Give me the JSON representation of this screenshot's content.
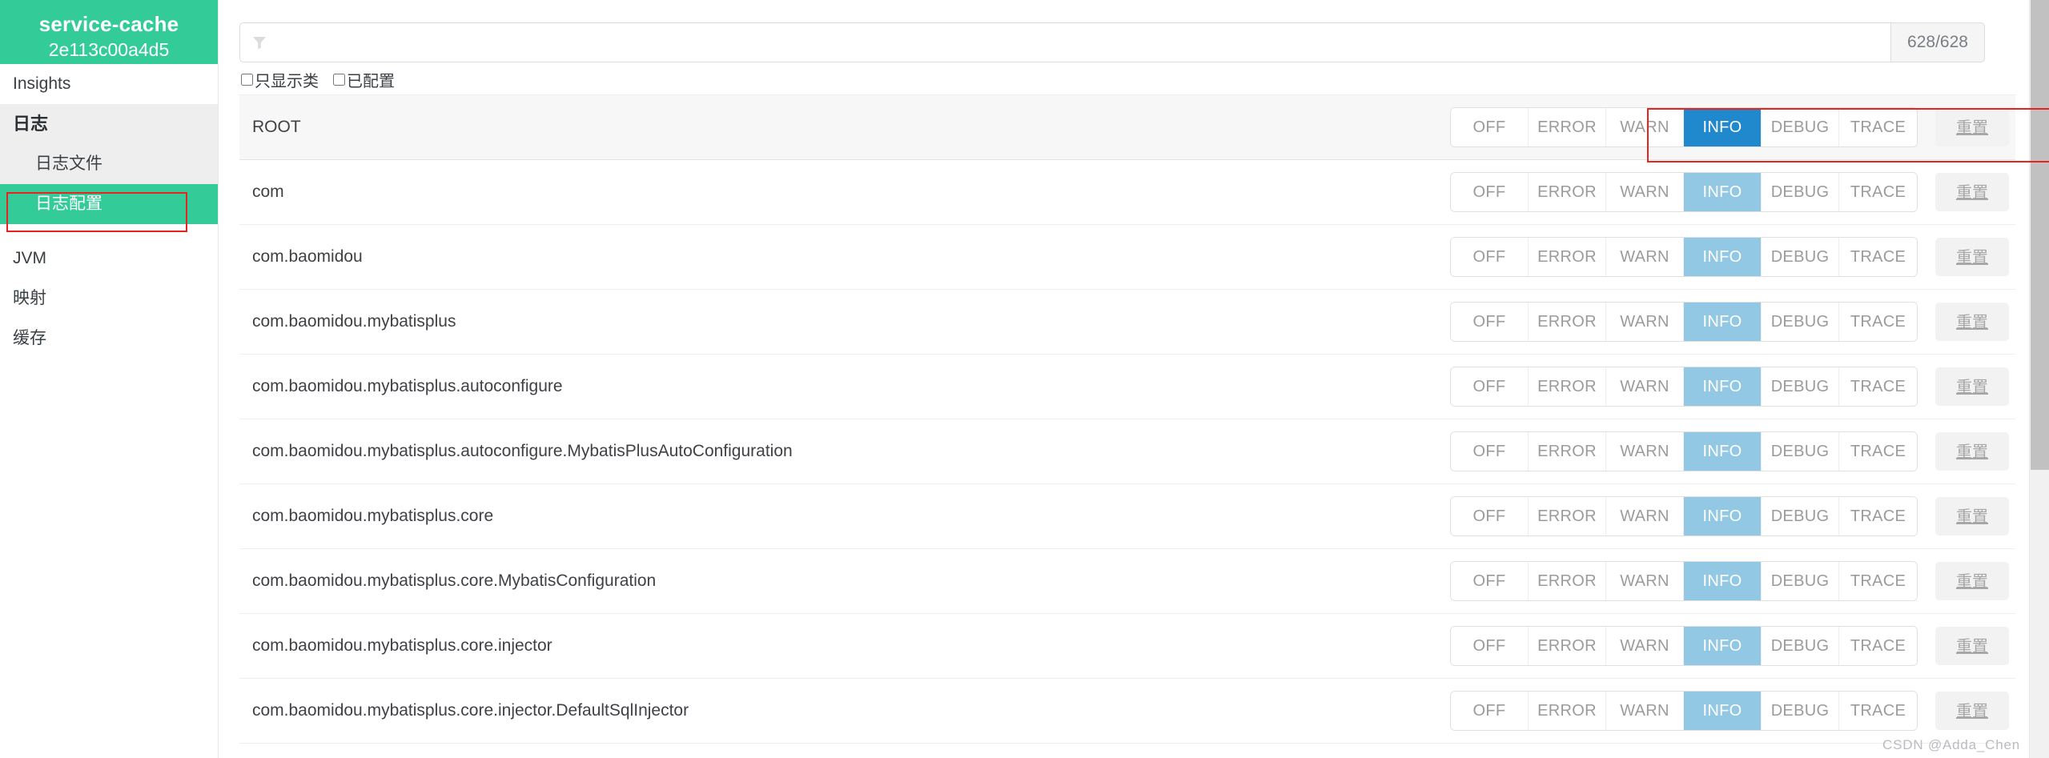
{
  "colors": {
    "brand_green": "#33cc99",
    "active_level_root": "#2088cd",
    "active_level_row": "#92c8e4",
    "annotation_red": "#e8221f",
    "row_root_bg": "#f7f7f7"
  },
  "sidebar": {
    "brand": {
      "title": "service-cache",
      "instance_id": "2e113c00a4d5"
    },
    "items": [
      {
        "label": "Insights",
        "type": "link",
        "active": false
      },
      {
        "label": "日志",
        "type": "section",
        "active": false
      },
      {
        "label": "日志文件",
        "type": "child",
        "active": false
      },
      {
        "label": "日志配置",
        "type": "child",
        "active": true
      },
      {
        "label": "JVM",
        "type": "link",
        "active": false
      },
      {
        "label": "映射",
        "type": "link",
        "active": false
      },
      {
        "label": "缓存",
        "type": "link",
        "active": false
      }
    ]
  },
  "toolbar": {
    "filter": {
      "icon": "funnel-icon",
      "value": "",
      "placeholder": ""
    },
    "count_badge": "628/628",
    "checkboxes": [
      {
        "label": "只显示类",
        "checked": false
      },
      {
        "label": "已配置",
        "checked": false
      }
    ]
  },
  "levels": [
    "OFF",
    "ERROR",
    "WARN",
    "INFO",
    "DEBUG",
    "TRACE"
  ],
  "reset_label": "重置",
  "loggers": [
    {
      "name": "ROOT",
      "level": "INFO",
      "is_root": true
    },
    {
      "name": "com",
      "level": "INFO",
      "is_root": false
    },
    {
      "name": "com.baomidou",
      "level": "INFO",
      "is_root": false
    },
    {
      "name": "com.baomidou.mybatisplus",
      "level": "INFO",
      "is_root": false
    },
    {
      "name": "com.baomidou.mybatisplus.autoconfigure",
      "level": "INFO",
      "is_root": false
    },
    {
      "name": "com.baomidou.mybatisplus.autoconfigure.MybatisPlusAutoConfiguration",
      "level": "INFO",
      "is_root": false
    },
    {
      "name": "com.baomidou.mybatisplus.core",
      "level": "INFO",
      "is_root": false
    },
    {
      "name": "com.baomidou.mybatisplus.core.MybatisConfiguration",
      "level": "INFO",
      "is_root": false
    },
    {
      "name": "com.baomidou.mybatisplus.core.injector",
      "level": "INFO",
      "is_root": false
    },
    {
      "name": "com.baomidou.mybatisplus.core.injector.DefaultSqlInjector",
      "level": "INFO",
      "is_root": false
    }
  ],
  "watermark": "CSDN @Adda_Chen",
  "scrollbar": {
    "thumb_ratio": 0.62
  }
}
